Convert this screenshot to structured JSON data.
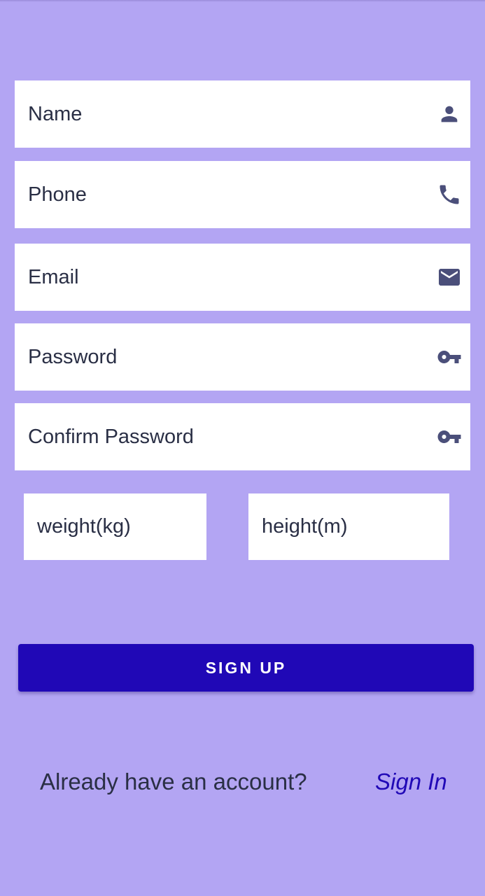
{
  "form": {
    "name": {
      "placeholder": "Name",
      "icon": "person-icon"
    },
    "phone": {
      "placeholder": "Phone",
      "icon": "phone-icon"
    },
    "email": {
      "placeholder": "Email",
      "icon": "email-icon"
    },
    "password": {
      "placeholder": "Password",
      "icon": "key-icon"
    },
    "confirm_password": {
      "placeholder": "Confirm Password",
      "icon": "key-icon"
    },
    "weight": {
      "placeholder": "weight(kg)"
    },
    "height": {
      "placeholder": "height(m)"
    }
  },
  "signup_button": {
    "label": "SIGN UP"
  },
  "footer": {
    "prompt": "Already have an account?",
    "signin_link": "Sign In"
  },
  "colors": {
    "background": "#b3a5f3",
    "field_background": "#ffffff",
    "primary": "#2008b6",
    "icon": "#4b4f7a",
    "text": "#2a2f45"
  }
}
